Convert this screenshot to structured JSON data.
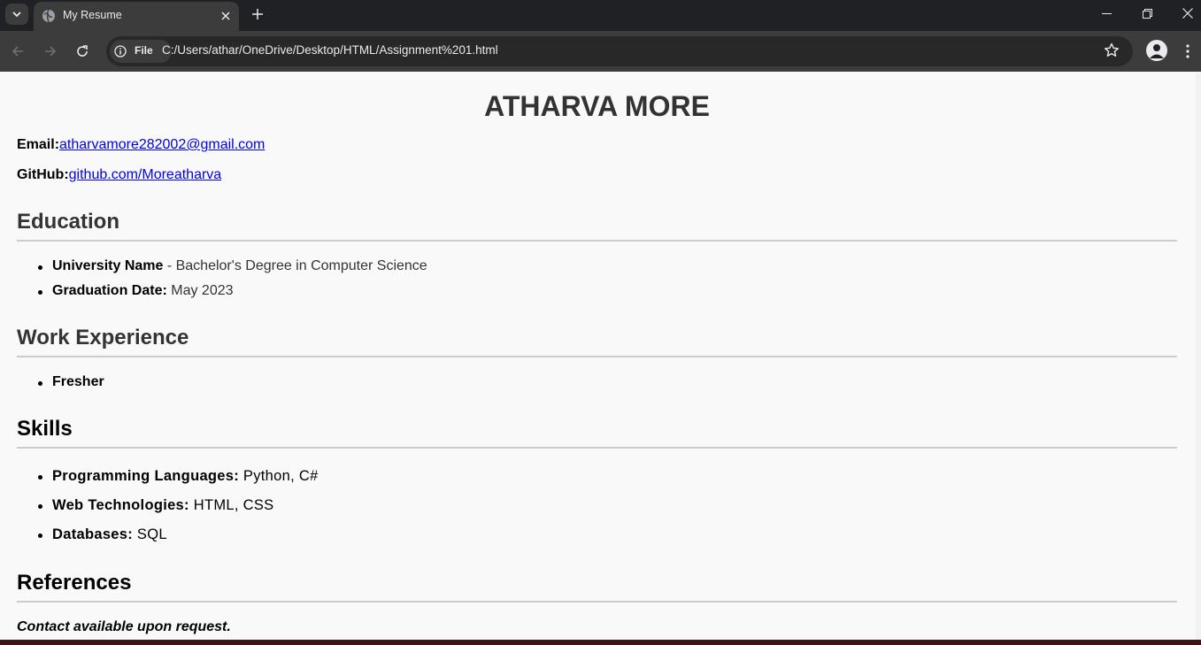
{
  "browser": {
    "tab_title": "My Resume",
    "url_chip": "File",
    "url": "C:/Users/athar/OneDrive/Desktop/HTML/Assignment%201.html"
  },
  "resume": {
    "name": "ATHARVA MORE",
    "email_label": "Email:",
    "email": "atharvamore282002@gmail.com",
    "github_label": "GitHub:",
    "github": "github.com/Moreatharva",
    "education": {
      "heading": "Education",
      "items": [
        {
          "label": "University Name",
          "text": " - Bachelor's Degree in Computer Science"
        },
        {
          "label": "Graduation Date:",
          "text": " May 2023"
        }
      ]
    },
    "work": {
      "heading": "Work Experience",
      "items": [
        {
          "label": "Fresher",
          "text": ""
        }
      ]
    },
    "skills": {
      "heading": "Skills",
      "items": [
        {
          "label": "Programming Languages:",
          "text": " Python, C#"
        },
        {
          "label": "Web Technologies:",
          "text": " HTML, CSS"
        },
        {
          "label": "Databases:",
          "text": " SQL"
        }
      ]
    },
    "references": {
      "heading": "References",
      "text": "Contact available upon request."
    }
  },
  "icons": [
    "tab-search-icon",
    "globe-icon",
    "close-icon",
    "plus-icon",
    "minimize-icon",
    "restore-icon",
    "window-close-icon",
    "back-icon",
    "forward-icon",
    "reload-icon",
    "info-icon",
    "star-icon",
    "profile-icon",
    "more-icon"
  ]
}
